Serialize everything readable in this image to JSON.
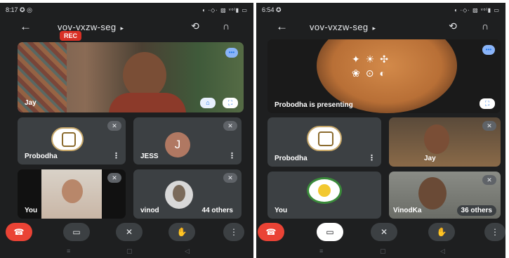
{
  "left": {
    "status": {
      "time": "8:17",
      "left_icons": "✪ ◎",
      "right": "◖ ·◇· ▨ ᵛᵒˡ▮ ▭"
    },
    "header": {
      "meeting_code": "vov-vxzw-seg",
      "rec": "REC"
    },
    "main_tile": {
      "name": "Jay"
    },
    "tiles": [
      {
        "name": "Probodha"
      },
      {
        "name": "JESS",
        "initial": "J"
      },
      {
        "name": "You"
      },
      {
        "name": "vinod",
        "others": "44 others"
      }
    ]
  },
  "right": {
    "status": {
      "time": "6:54",
      "left_icons": "✪",
      "right": "◖ ·◇· ▨ ᵛᵒˡ▮ ▭"
    },
    "header": {
      "meeting_code": "vov-vxzw-seg"
    },
    "presenting": {
      "text": "Probodha is presenting"
    },
    "tiles": [
      {
        "name": "Probodha"
      },
      {
        "name": "Jay"
      },
      {
        "name": "You"
      },
      {
        "name": "VinodKa",
        "others": "36 others"
      }
    ]
  },
  "icons": {
    "back": "←",
    "arrow": "▸",
    "switch_camera": "⟲",
    "audio": "∩",
    "end_call": "☎",
    "camera": "▭",
    "mic_off": "✕",
    "hand": "✋",
    "more": "⋮",
    "pin": "⌂",
    "fullscreen": "⛶",
    "speaking": "•••"
  },
  "colors": {
    "end_call": "#ea4335",
    "rec": "#d93025",
    "background": "#1e1f20",
    "tile": "#3c4043"
  }
}
